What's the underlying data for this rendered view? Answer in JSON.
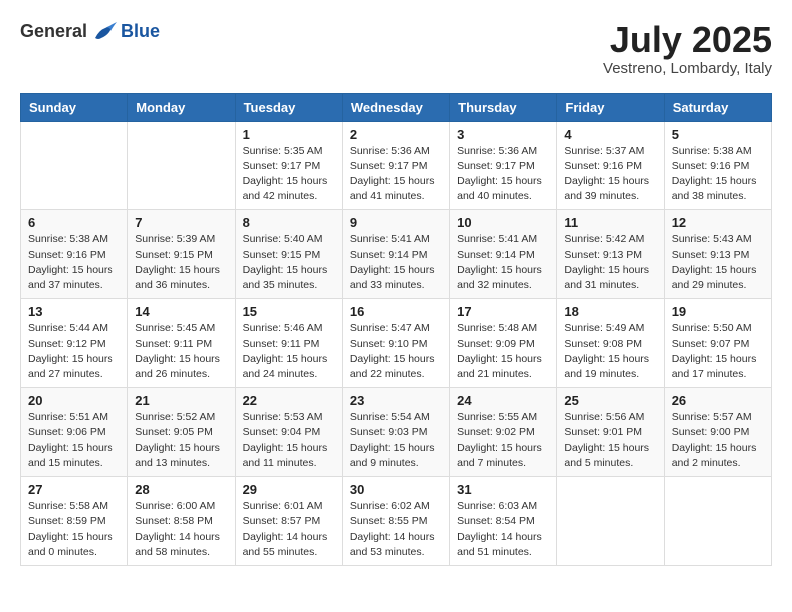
{
  "logo": {
    "general": "General",
    "blue": "Blue"
  },
  "title": "July 2025",
  "subtitle": "Vestreno, Lombardy, Italy",
  "headers": [
    "Sunday",
    "Monday",
    "Tuesday",
    "Wednesday",
    "Thursday",
    "Friday",
    "Saturday"
  ],
  "weeks": [
    [
      {
        "day": "",
        "info": ""
      },
      {
        "day": "",
        "info": ""
      },
      {
        "day": "1",
        "info": "Sunrise: 5:35 AM\nSunset: 9:17 PM\nDaylight: 15 hours\nand 42 minutes."
      },
      {
        "day": "2",
        "info": "Sunrise: 5:36 AM\nSunset: 9:17 PM\nDaylight: 15 hours\nand 41 minutes."
      },
      {
        "day": "3",
        "info": "Sunrise: 5:36 AM\nSunset: 9:17 PM\nDaylight: 15 hours\nand 40 minutes."
      },
      {
        "day": "4",
        "info": "Sunrise: 5:37 AM\nSunset: 9:16 PM\nDaylight: 15 hours\nand 39 minutes."
      },
      {
        "day": "5",
        "info": "Sunrise: 5:38 AM\nSunset: 9:16 PM\nDaylight: 15 hours\nand 38 minutes."
      }
    ],
    [
      {
        "day": "6",
        "info": "Sunrise: 5:38 AM\nSunset: 9:16 PM\nDaylight: 15 hours\nand 37 minutes."
      },
      {
        "day": "7",
        "info": "Sunrise: 5:39 AM\nSunset: 9:15 PM\nDaylight: 15 hours\nand 36 minutes."
      },
      {
        "day": "8",
        "info": "Sunrise: 5:40 AM\nSunset: 9:15 PM\nDaylight: 15 hours\nand 35 minutes."
      },
      {
        "day": "9",
        "info": "Sunrise: 5:41 AM\nSunset: 9:14 PM\nDaylight: 15 hours\nand 33 minutes."
      },
      {
        "day": "10",
        "info": "Sunrise: 5:41 AM\nSunset: 9:14 PM\nDaylight: 15 hours\nand 32 minutes."
      },
      {
        "day": "11",
        "info": "Sunrise: 5:42 AM\nSunset: 9:13 PM\nDaylight: 15 hours\nand 31 minutes."
      },
      {
        "day": "12",
        "info": "Sunrise: 5:43 AM\nSunset: 9:13 PM\nDaylight: 15 hours\nand 29 minutes."
      }
    ],
    [
      {
        "day": "13",
        "info": "Sunrise: 5:44 AM\nSunset: 9:12 PM\nDaylight: 15 hours\nand 27 minutes."
      },
      {
        "day": "14",
        "info": "Sunrise: 5:45 AM\nSunset: 9:11 PM\nDaylight: 15 hours\nand 26 minutes."
      },
      {
        "day": "15",
        "info": "Sunrise: 5:46 AM\nSunset: 9:11 PM\nDaylight: 15 hours\nand 24 minutes."
      },
      {
        "day": "16",
        "info": "Sunrise: 5:47 AM\nSunset: 9:10 PM\nDaylight: 15 hours\nand 22 minutes."
      },
      {
        "day": "17",
        "info": "Sunrise: 5:48 AM\nSunset: 9:09 PM\nDaylight: 15 hours\nand 21 minutes."
      },
      {
        "day": "18",
        "info": "Sunrise: 5:49 AM\nSunset: 9:08 PM\nDaylight: 15 hours\nand 19 minutes."
      },
      {
        "day": "19",
        "info": "Sunrise: 5:50 AM\nSunset: 9:07 PM\nDaylight: 15 hours\nand 17 minutes."
      }
    ],
    [
      {
        "day": "20",
        "info": "Sunrise: 5:51 AM\nSunset: 9:06 PM\nDaylight: 15 hours\nand 15 minutes."
      },
      {
        "day": "21",
        "info": "Sunrise: 5:52 AM\nSunset: 9:05 PM\nDaylight: 15 hours\nand 13 minutes."
      },
      {
        "day": "22",
        "info": "Sunrise: 5:53 AM\nSunset: 9:04 PM\nDaylight: 15 hours\nand 11 minutes."
      },
      {
        "day": "23",
        "info": "Sunrise: 5:54 AM\nSunset: 9:03 PM\nDaylight: 15 hours\nand 9 minutes."
      },
      {
        "day": "24",
        "info": "Sunrise: 5:55 AM\nSunset: 9:02 PM\nDaylight: 15 hours\nand 7 minutes."
      },
      {
        "day": "25",
        "info": "Sunrise: 5:56 AM\nSunset: 9:01 PM\nDaylight: 15 hours\nand 5 minutes."
      },
      {
        "day": "26",
        "info": "Sunrise: 5:57 AM\nSunset: 9:00 PM\nDaylight: 15 hours\nand 2 minutes."
      }
    ],
    [
      {
        "day": "27",
        "info": "Sunrise: 5:58 AM\nSunset: 8:59 PM\nDaylight: 15 hours\nand 0 minutes."
      },
      {
        "day": "28",
        "info": "Sunrise: 6:00 AM\nSunset: 8:58 PM\nDaylight: 14 hours\nand 58 minutes."
      },
      {
        "day": "29",
        "info": "Sunrise: 6:01 AM\nSunset: 8:57 PM\nDaylight: 14 hours\nand 55 minutes."
      },
      {
        "day": "30",
        "info": "Sunrise: 6:02 AM\nSunset: 8:55 PM\nDaylight: 14 hours\nand 53 minutes."
      },
      {
        "day": "31",
        "info": "Sunrise: 6:03 AM\nSunset: 8:54 PM\nDaylight: 14 hours\nand 51 minutes."
      },
      {
        "day": "",
        "info": ""
      },
      {
        "day": "",
        "info": ""
      }
    ]
  ]
}
